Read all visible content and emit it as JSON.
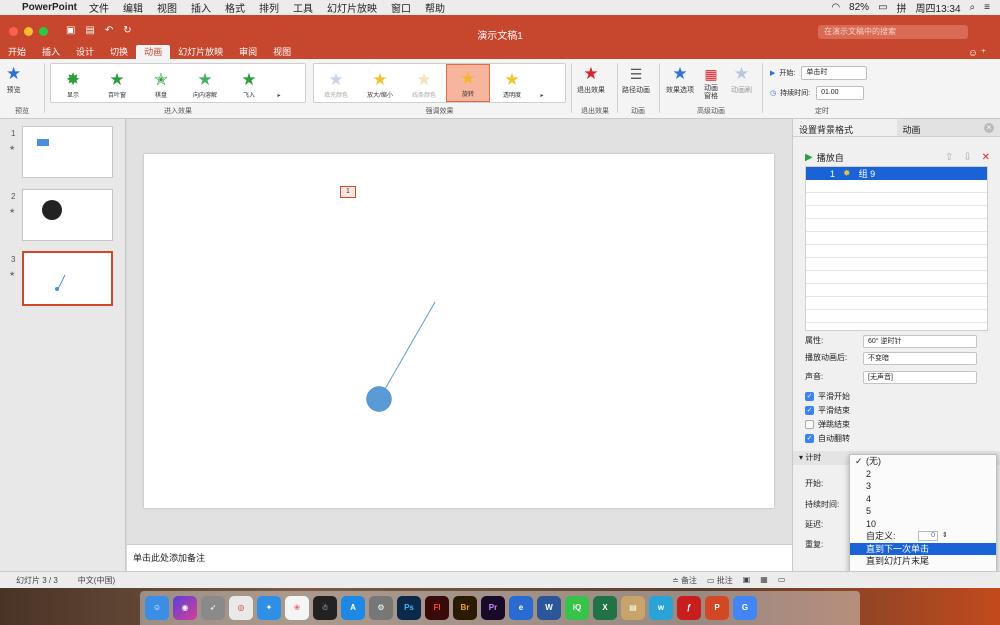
{
  "menubar": {
    "app": "PowerPoint",
    "items": [
      "文件",
      "编辑",
      "视图",
      "插入",
      "格式",
      "排列",
      "工具",
      "幻灯片放映",
      "窗口",
      "帮助"
    ],
    "battery": "82%",
    "input_method": "拼",
    "clock": "周四13:34"
  },
  "title": "演示文稿1",
  "search_placeholder": "在演示文稿中的搜索",
  "tabs": [
    "开始",
    "插入",
    "设计",
    "切换",
    "动画",
    "幻灯片放映",
    "审阅",
    "视图"
  ],
  "active_tab": "动画",
  "ribbon": {
    "preview": "预览",
    "preview_group": "预览",
    "entrance": [
      "显示",
      "百叶窗",
      "棋盘",
      "向内溶解",
      "飞入"
    ],
    "entrance_group": "进入效果",
    "emphasis": [
      "填充颜色",
      "放大/缩小",
      "线条颜色",
      "旋转",
      "透明度"
    ],
    "emphasis_group": "强调效果",
    "exit": "退出效果",
    "exit_group": "退出效果",
    "path": "路径动画",
    "path_group": "动画",
    "effect_options": "效果选项",
    "anim_pane": "动画\n窗格",
    "anim_painter": "动画刷",
    "advanced_group": "高级动画",
    "start_label": "开始:",
    "start_value": "单击时",
    "duration_label": "持续时间:",
    "duration_value": "01.00",
    "timing_group": "定时"
  },
  "slides": [
    {
      "num": "1",
      "star": "★"
    },
    {
      "num": "2",
      "star": "★"
    },
    {
      "num": "3",
      "star": "★"
    }
  ],
  "slide_badge": "1",
  "notes_placeholder": "单击此处添加备注",
  "right_pane": {
    "tab_bg": "设置背景格式",
    "tab_anim": "动画",
    "play_from": "播放自",
    "anim_item_num": "1",
    "anim_item_name": "组 9",
    "prop_label": "属性:",
    "prop_value": "60° 逆时针",
    "after_label": "播放动画后:",
    "after_value": "不变暗",
    "sound_label": "声音:",
    "sound_value": "[无声音]",
    "checks": [
      {
        "label": "平滑开始",
        "checked": true
      },
      {
        "label": "平滑结束",
        "checked": true
      },
      {
        "label": "弹跳结束",
        "checked": false
      },
      {
        "label": "自动翻转",
        "checked": true
      }
    ],
    "timing_section": "计时",
    "t_start": "开始:",
    "t_duration": "持续时间:",
    "t_delay": "延迟:",
    "t_repeat": "重复:",
    "t_custom": "自定义:",
    "t_custom_value": "0"
  },
  "dropdown": {
    "items": [
      "(无)",
      "2",
      "3",
      "4",
      "5",
      "10",
      "直到下一次单击",
      "直到幻灯片末尾"
    ],
    "checked_index": 0,
    "highlight_index": 6
  },
  "status": {
    "slide_info": "幻灯片 3 / 3",
    "language": "中文(中国)",
    "notes_btn": "备注",
    "comments_btn": "批注"
  },
  "dock_apps": [
    "Finder",
    "Siri",
    "Launchpad",
    "Chrome",
    "Safari",
    "Photos",
    "QQ",
    "App Store",
    "Prefs",
    "Ps",
    "Fl",
    "Br",
    "Pr",
    "Edge",
    "Word",
    "iQIYI",
    "Excel",
    "Preview",
    "Wunderlist",
    "Flash",
    "PowerPoint",
    "Google"
  ],
  "colors": {
    "brand_red": "#c7472e",
    "selection_blue": "#1a63d6",
    "shape_blue": "#4a90d9"
  }
}
